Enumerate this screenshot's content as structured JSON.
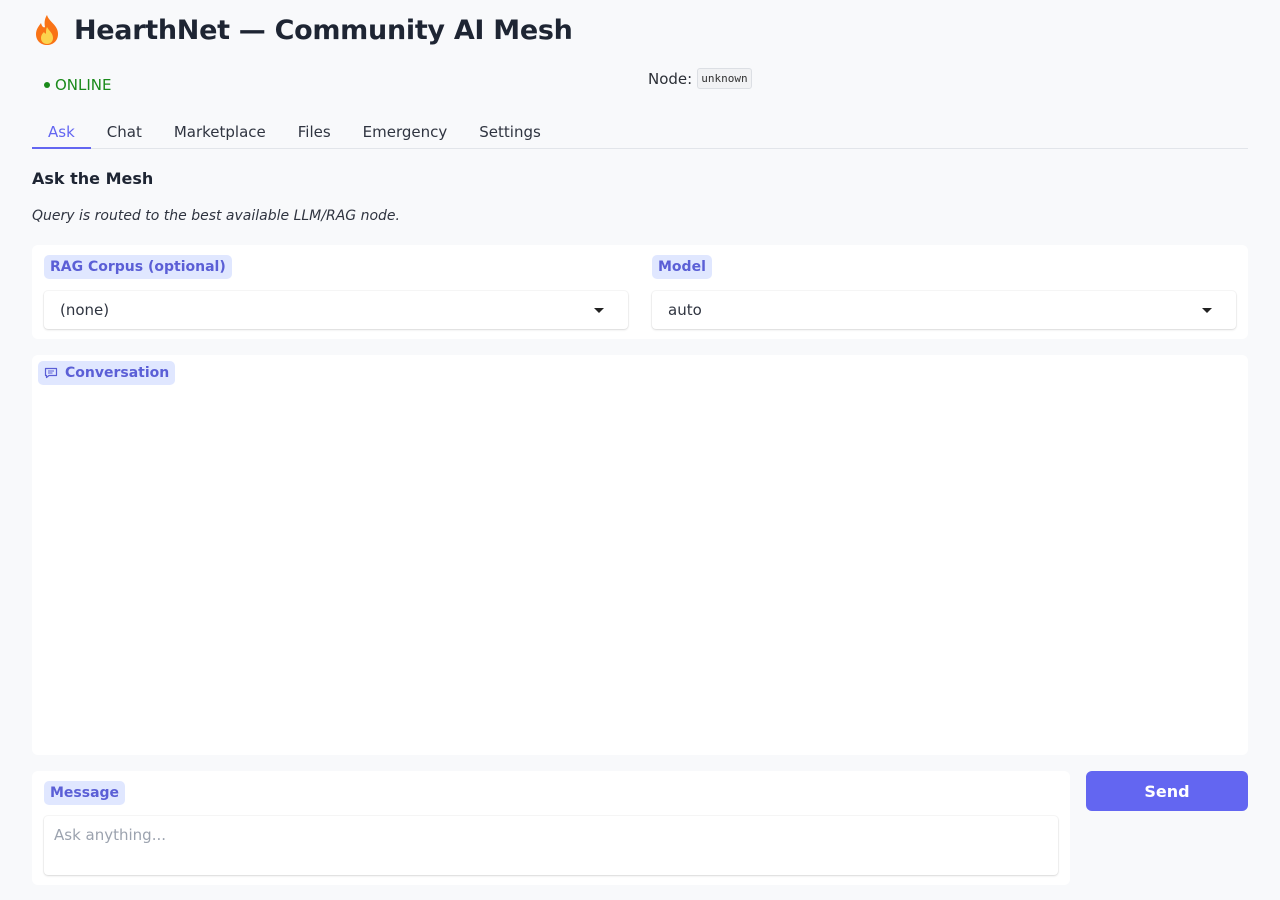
{
  "app": {
    "title": "HearthNet — Community AI Mesh"
  },
  "status": {
    "state": "ONLINE",
    "node_label": "Node:",
    "node_value": "unknown"
  },
  "tabs": [
    {
      "label": "Ask",
      "active": true
    },
    {
      "label": "Chat",
      "active": false
    },
    {
      "label": "Marketplace",
      "active": false
    },
    {
      "label": "Files",
      "active": false
    },
    {
      "label": "Emergency",
      "active": false
    },
    {
      "label": "Settings",
      "active": false
    }
  ],
  "ask": {
    "title": "Ask the Mesh",
    "description": "Query is routed to the best available LLM/RAG node.",
    "rag": {
      "label": "RAG Corpus (optional)",
      "value": "(none)"
    },
    "model": {
      "label": "Model",
      "value": "auto"
    },
    "conversation": {
      "label": "Conversation"
    },
    "message": {
      "label": "Message",
      "placeholder": "Ask anything..."
    },
    "send_label": "Send"
  },
  "colors": {
    "accent": "#6366f1",
    "online": "#1a8a1a",
    "chip_bg": "#e0e7ff"
  },
  "icons": {
    "logo": "flame-icon",
    "conversation": "chat-bubble-icon",
    "dropdown": "caret-down-icon"
  }
}
